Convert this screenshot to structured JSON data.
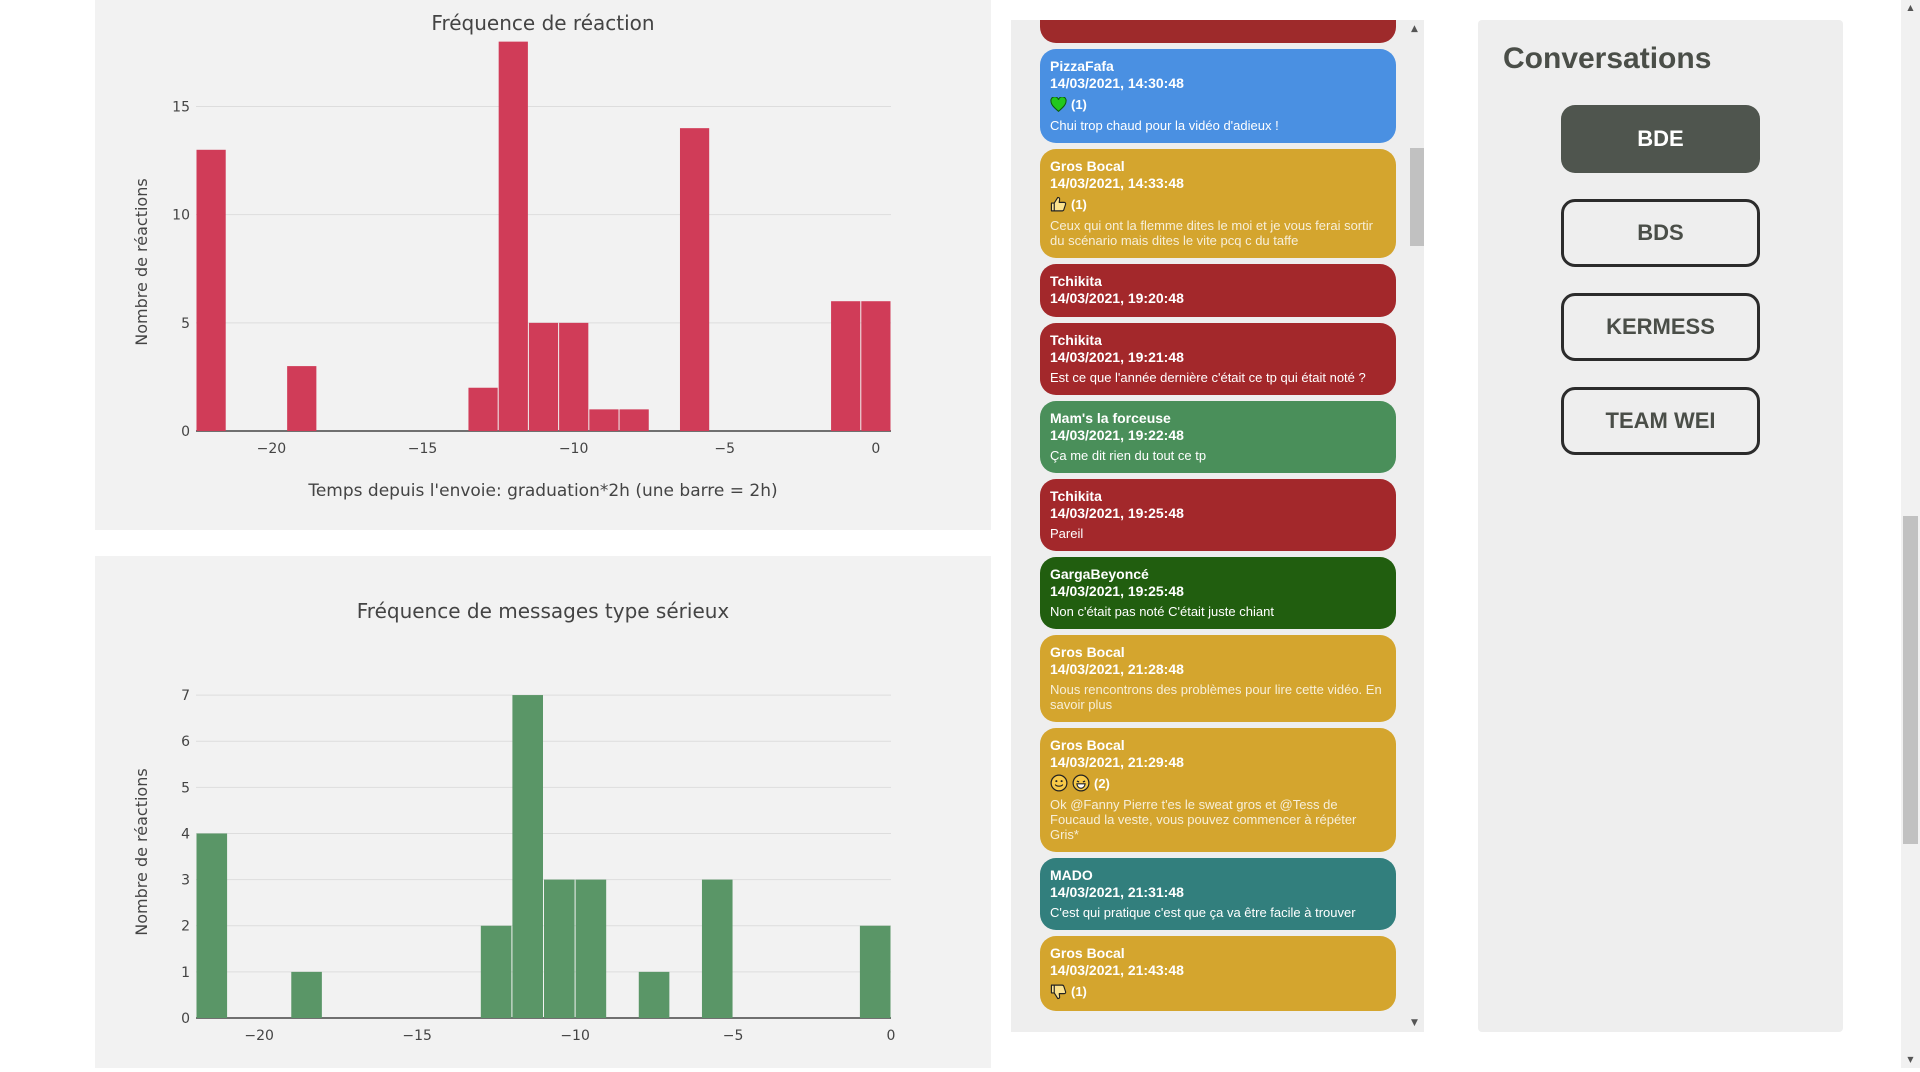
{
  "charts": {
    "reactions": {
      "title": "Fréquence de réaction",
      "xlabel": "Temps depuis l'envoie: graduation*2h (une barre = 2h)",
      "ylabel": "Nombre de réactions",
      "color": "#d03c58"
    },
    "serious": {
      "title": "Fréquence de messages type sérieux",
      "xlabel": "",
      "ylabel": "Nombre de réactions",
      "color": "#5a9667"
    }
  },
  "chart_data": [
    {
      "type": "bar",
      "title": "Fréquence de réaction",
      "xlabel": "Temps depuis l'envoie: graduation*2h (une barre = 2h)",
      "ylabel": "Nombre de réactions",
      "x": [
        -22,
        -21,
        -20,
        -19,
        -18,
        -17,
        -16,
        -15,
        -14,
        -13,
        -12,
        -11,
        -10,
        -9,
        -8,
        -7,
        -6,
        -5,
        -4,
        -3,
        -2,
        -1,
        0
      ],
      "values": [
        13,
        0,
        0,
        3,
        0,
        0,
        0,
        0,
        0,
        2,
        18,
        5,
        5,
        1,
        1,
        0,
        14,
        0,
        0,
        0,
        0,
        6,
        6
      ],
      "xlim": [
        -22,
        1
      ],
      "ylim": [
        0,
        19
      ],
      "xticks": [
        -20,
        -15,
        -10,
        -5,
        0
      ],
      "xtick_labels": [
        "−20",
        "−15",
        "−10",
        "−5",
        "0"
      ],
      "yticks": [
        0,
        5,
        10,
        15
      ],
      "grid": true
    },
    {
      "type": "bar",
      "title": "Fréquence de messages type sérieux",
      "xlabel": "",
      "ylabel": "Nombre de réactions",
      "x": [
        -22,
        -21,
        -20,
        -19,
        -18,
        -17,
        -16,
        -15,
        -14,
        -13,
        -12,
        -11,
        -10,
        -9,
        -8,
        -7,
        -6,
        -5,
        -4,
        -3,
        -2,
        -1,
        0
      ],
      "values": [
        4,
        0,
        0,
        1,
        0,
        0,
        0,
        0,
        0,
        2,
        7,
        3,
        3,
        0,
        1,
        0,
        3,
        0,
        0,
        0,
        0,
        2,
        0
      ],
      "xlim": [
        -22,
        0
      ],
      "ylim": [
        0,
        7.5
      ],
      "xticks": [
        -20,
        -15,
        -10,
        -5,
        0
      ],
      "xtick_labels": [
        "−20",
        "−15",
        "−10",
        "−5",
        "0"
      ],
      "yticks": [
        0,
        1,
        2,
        3,
        4,
        5,
        6,
        7
      ],
      "grid": true
    }
  ],
  "chat": {
    "top_stub_color": "#9e2a2b",
    "messages": [
      {
        "author": "PizzaFafa",
        "date": "14/03/2021, 14:30:48",
        "reaction_icons": [
          "green-heart"
        ],
        "reaction_count": "(1)",
        "text": "Chui trop chaud pour la vidéo d'adieux !",
        "color": "#4a90e2",
        "faded": false
      },
      {
        "author": "Gros Bocal",
        "date": "14/03/2021, 14:33:48",
        "reaction_icons": [
          "thumbs-up"
        ],
        "reaction_count": "(1)",
        "text": "Ceux qui ont la flemme dites le moi et je vous ferai sortir du scénario mais dites le vite pcq c du taffe",
        "color": "#d4a52e",
        "faded": true
      },
      {
        "author": "Tchikita",
        "date": "14/03/2021, 19:20:48",
        "reaction_icons": [],
        "reaction_count": "",
        "text": "",
        "color": "#a3282b",
        "faded": false
      },
      {
        "author": "Tchikita",
        "date": "14/03/2021, 19:21:48",
        "reaction_icons": [],
        "reaction_count": "",
        "text": "Est ce que l'année dernière c'était ce tp qui était noté ?",
        "color": "#a3282b",
        "faded": false
      },
      {
        "author": "Mam's la forceuse",
        "date": "14/03/2021, 19:22:48",
        "reaction_icons": [],
        "reaction_count": "",
        "text": "Ça me dit rien du tout ce tp",
        "color": "#4a8f5a",
        "faded": false
      },
      {
        "author": "Tchikita",
        "date": "14/03/2021, 19:25:48",
        "reaction_icons": [],
        "reaction_count": "",
        "text": "Pareil",
        "color": "#a3282b",
        "faded": false
      },
      {
        "author": "GargaBeyoncé",
        "date": "14/03/2021, 19:25:48",
        "reaction_icons": [],
        "reaction_count": "",
        "text": "Non c'était pas noté C'était juste chiant",
        "color": "#215e0f",
        "faded": false
      },
      {
        "author": "Gros Bocal",
        "date": "14/03/2021, 21:28:48",
        "reaction_icons": [],
        "reaction_count": "",
        "text": "Nous rencontrons des problèmes pour lire cette vidéo. En savoir plus",
        "color": "#d4a52e",
        "faded": true
      },
      {
        "author": "Gros Bocal",
        "date": "14/03/2021, 21:29:48",
        "reaction_icons": [
          "smile-face",
          "laugh-face"
        ],
        "reaction_count": "(2)",
        "text": "Ok @Fanny Pierre t'es le sweat gros et @Tess de Foucaud la veste, vous pouvez commencer à répéter Gris*",
        "color": "#d4a52e",
        "faded": true
      },
      {
        "author": "MADO",
        "date": "14/03/2021, 21:31:48",
        "reaction_icons": [],
        "reaction_count": "",
        "text": "C'est qui pratique c'est que ça va être facile à trouver",
        "color": "#327f7d",
        "faded": false
      },
      {
        "author": "Gros Bocal",
        "date": "14/03/2021, 21:43:48",
        "reaction_icons": [
          "thumbs-down"
        ],
        "reaction_count": "(1)",
        "text": "",
        "color": "#d4a52e",
        "faded": true
      }
    ],
    "scroll_up": "▲",
    "scroll_down": "▼"
  },
  "conversations": {
    "title": "Conversations",
    "items": [
      {
        "label": "BDE",
        "active": true
      },
      {
        "label": "BDS",
        "active": false
      },
      {
        "label": "KERMESS",
        "active": false
      },
      {
        "label": "TEAM WEI",
        "active": false
      }
    ]
  }
}
